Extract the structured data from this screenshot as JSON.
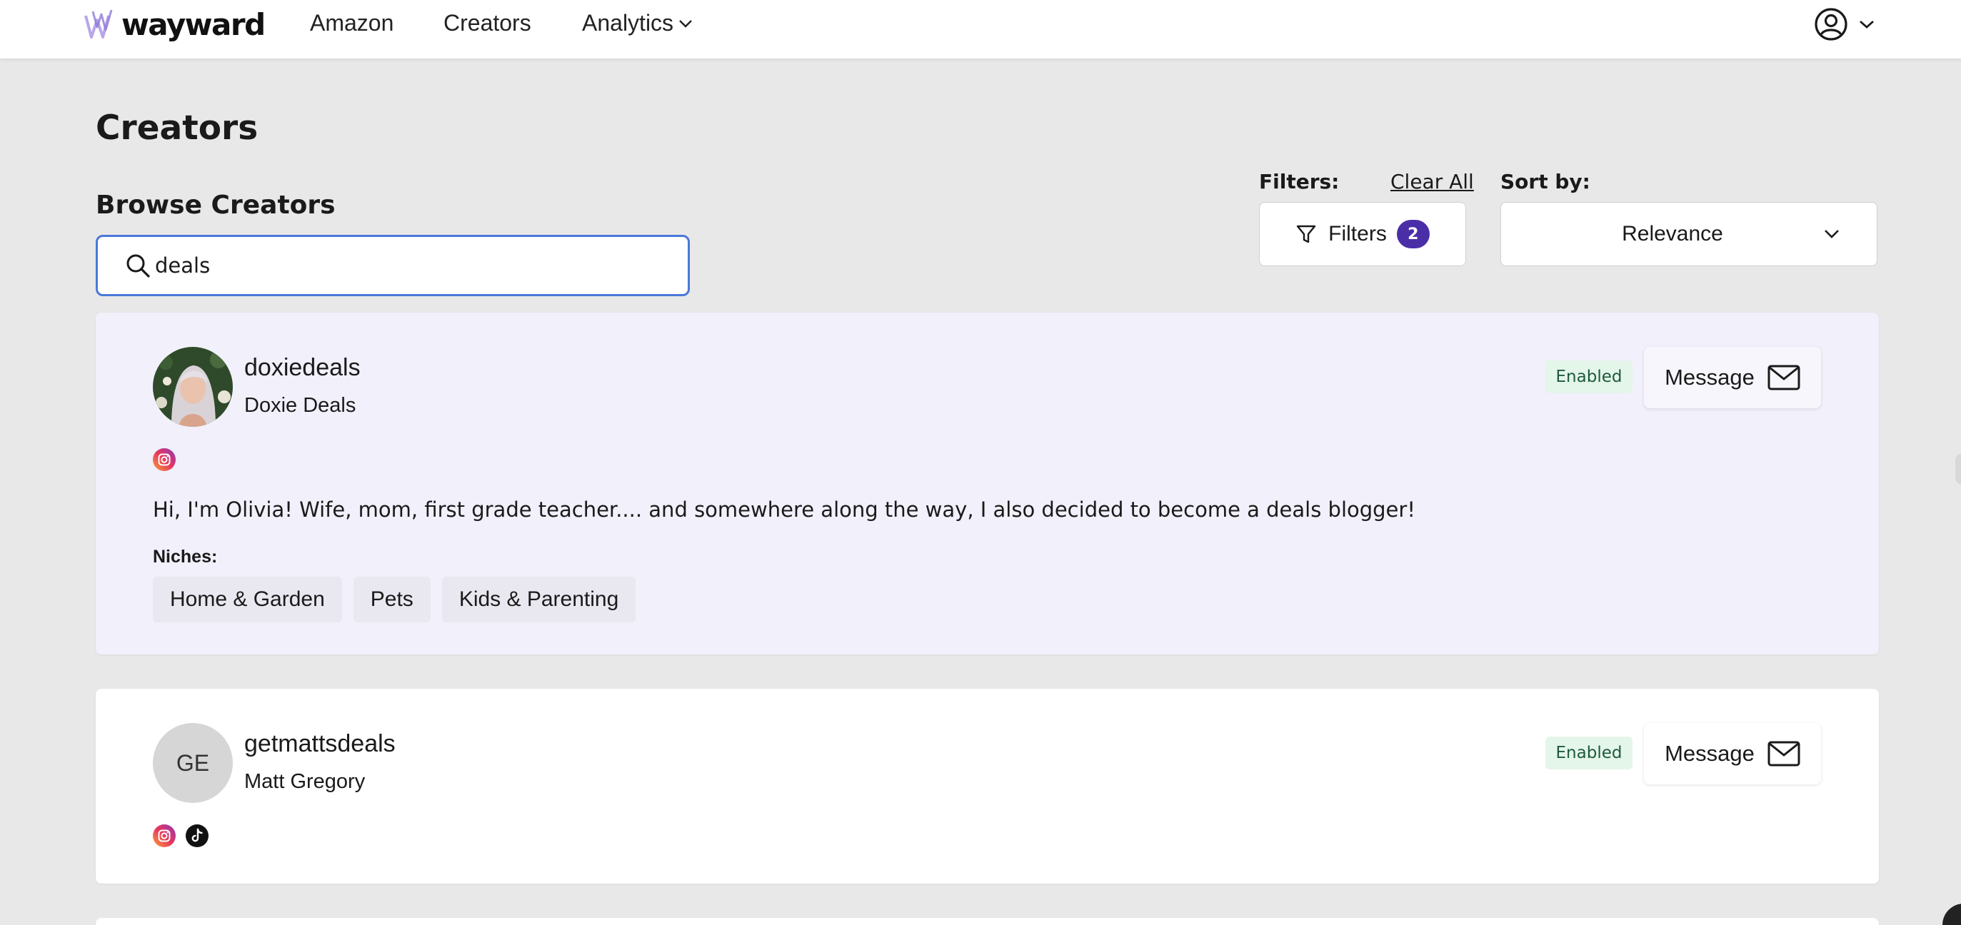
{
  "nav": {
    "logo_text": "wayward",
    "links": [
      "Amazon",
      "Creators",
      "Analytics"
    ]
  },
  "page": {
    "title": "Creators",
    "section_title": "Browse Creators"
  },
  "search": {
    "value": "deals",
    "placeholder": ""
  },
  "filters": {
    "label": "Filters:",
    "clear_all": "Clear All",
    "button_label": "Filters",
    "count": "2"
  },
  "sort": {
    "label": "Sort by:",
    "value": "Relevance"
  },
  "creators": [
    {
      "handle": "doxiedeals",
      "name": "Doxie Deals",
      "status": "Enabled",
      "message_label": "Message",
      "socials": [
        "instagram-icon"
      ],
      "bio": "Hi, I'm Olivia! Wife, mom, first grade teacher.... and somewhere along the way, I also decided to become a deals blogger!",
      "niches_label": "Niches:",
      "niches": [
        "Home & Garden",
        "Pets",
        "Kids & Parenting"
      ]
    },
    {
      "handle": "getmattsdeals",
      "name": "Matt Gregory",
      "initials": "GE",
      "status": "Enabled",
      "message_label": "Message",
      "socials": [
        "instagram-icon",
        "tiktok-icon"
      ]
    }
  ],
  "colors": {
    "accent": "#4a2ea8",
    "search_focus": "#4a78d8",
    "enabled_bg": "#e4f5ea",
    "enabled_text": "#1e5a3a",
    "highlight_card": "#f1f0fb"
  }
}
